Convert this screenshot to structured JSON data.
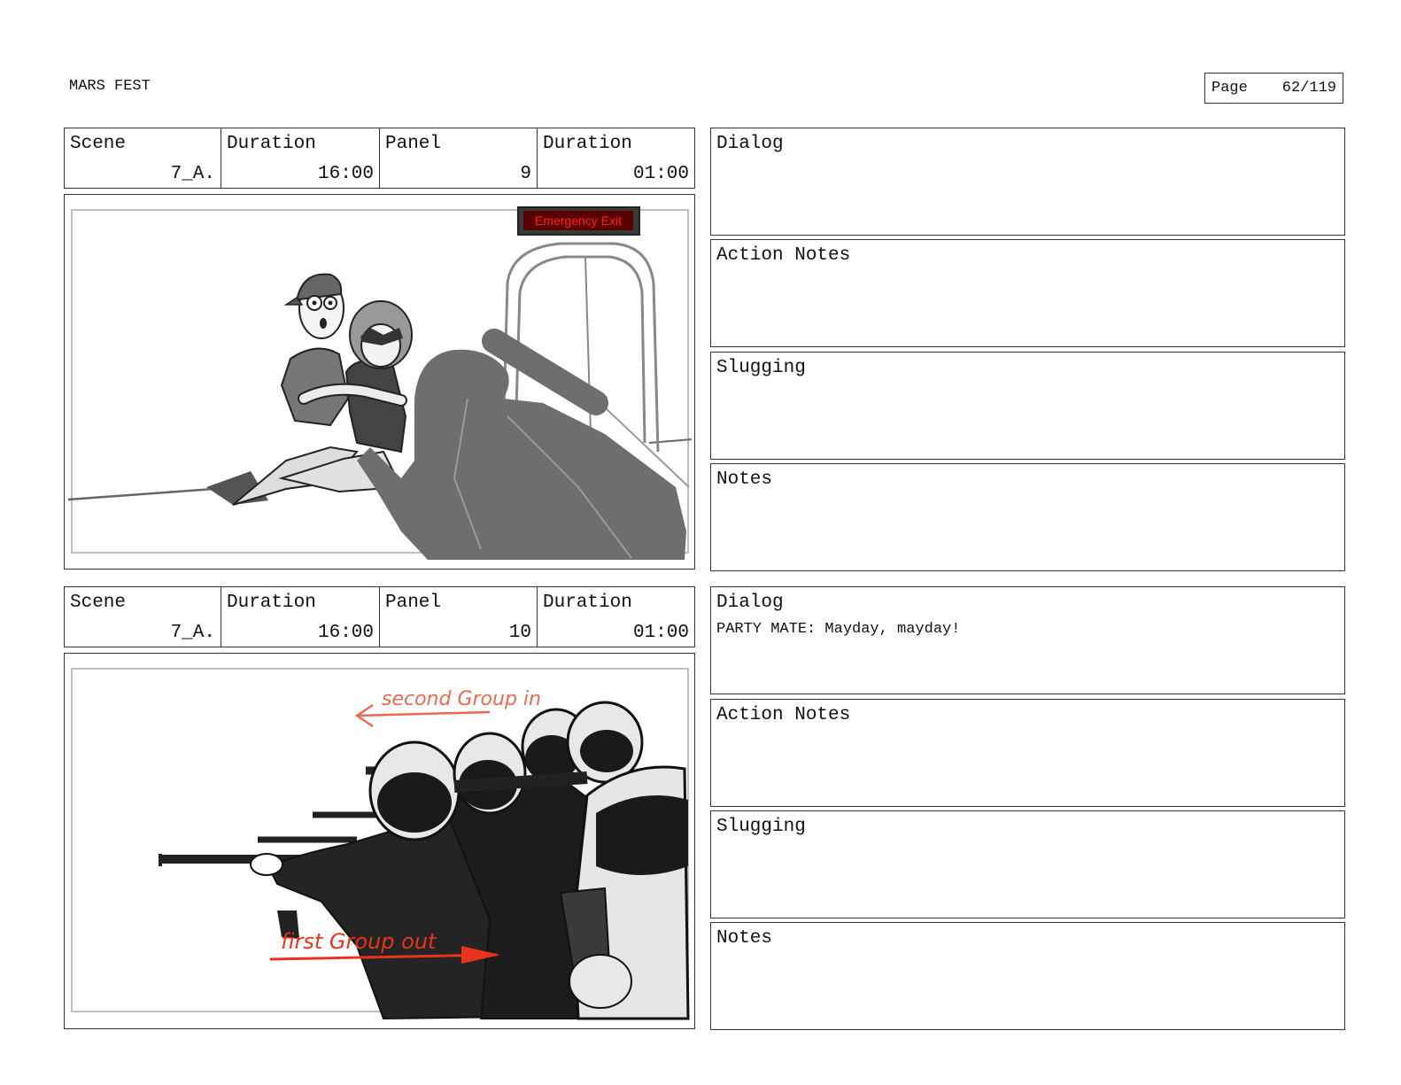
{
  "header": {
    "project_title": "MARS FEST",
    "page_label": "Page",
    "page_number": "62/119"
  },
  "panels": [
    {
      "scene_label": "Scene",
      "scene": "7_A.",
      "scene_duration_label": "Duration",
      "scene_duration": "16:00",
      "panel_label": "Panel",
      "panel": "9",
      "panel_duration_label": "Duration",
      "panel_duration": "01:00",
      "sign_text": "Emergency Exit",
      "dialog_label": "Dialog",
      "dialog": "",
      "action_notes_label": "Action Notes",
      "action_notes": "",
      "slugging_label": "Slugging",
      "slugging": "",
      "notes_label": "Notes",
      "notes": ""
    },
    {
      "scene_label": "Scene",
      "scene": "7_A.",
      "scene_duration_label": "Duration",
      "scene_duration": "16:00",
      "panel_label": "Panel",
      "panel": "10",
      "panel_duration_label": "Duration",
      "panel_duration": "01:00",
      "annotation_top": "second Group in",
      "annotation_bottom": "first Group out",
      "dialog_label": "Dialog",
      "dialog": "PARTY MATE: Mayday, mayday!",
      "action_notes_label": "Action Notes",
      "action_notes": "",
      "slugging_label": "Slugging",
      "slugging": "",
      "notes_label": "Notes",
      "notes": ""
    }
  ]
}
